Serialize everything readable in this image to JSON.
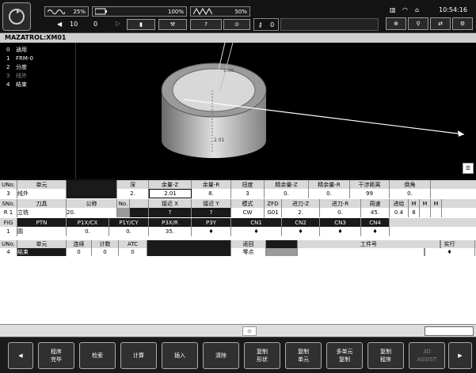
{
  "topbar": {
    "spindle_pct": "25%",
    "feed_pct": "100%",
    "rapid_pct": "50%",
    "step_value": "10",
    "step_value2": "0",
    "counter": "0",
    "clock": "10:54:16"
  },
  "title": "MAZATROL:XM01",
  "menu": [
    {
      "num": "0",
      "label": "通用"
    },
    {
      "num": "1",
      "label": "FRM-0"
    },
    {
      "num": "2",
      "label": "分度"
    },
    {
      "num": "3",
      "label": "线外"
    },
    {
      "num": "4",
      "label": "结束"
    }
  ],
  "view": {
    "label1": "1.36",
    "label2": "2.01"
  },
  "unit_table": {
    "header": [
      "UNo.",
      "单元",
      "",
      "深",
      "余量-Z",
      "余量-R",
      "扭度",
      "精余量-Z",
      "精余量-R",
      "干涉距离",
      "倒角"
    ],
    "row": [
      "3",
      "线外",
      "",
      "2.",
      "2.01",
      "8.",
      "3",
      "0.",
      "0.",
      "99",
      "0."
    ]
  },
  "tool_table": {
    "header": [
      "SNo.",
      "刀具",
      "公称",
      "No.",
      "",
      "接近 X",
      "接近 Y",
      "模式",
      "ZFD",
      "进刀-Z",
      "进刀-R",
      "周速",
      "进给",
      "M",
      "M",
      "M"
    ],
    "row": [
      "R 1",
      "立铣",
      "20.",
      "",
      "",
      "?",
      "?",
      "CW",
      "G01",
      "2.",
      "0.",
      "45.",
      "0.4",
      "8",
      "",
      ""
    ]
  },
  "fig_table": {
    "header": [
      "FIG",
      "PTN",
      "P1X/CX",
      "P1Y/CY",
      "P3X/R",
      "P3Y",
      "CN1",
      "CN2",
      "CN3",
      "CN4"
    ],
    "row": [
      "1",
      "圆",
      "0.",
      "0.",
      "35.",
      "♦",
      "♦",
      "♦",
      "♦",
      "♦"
    ]
  },
  "end_table": {
    "header": [
      "UNo.",
      "单元",
      "连续",
      "计数",
      "ATC",
      "",
      "返回",
      "",
      "工件号",
      "",
      "实行"
    ],
    "row": [
      "4",
      "结束",
      "0",
      "0",
      "0",
      "",
      "零点",
      "",
      "",
      "",
      "♦"
    ]
  },
  "fkeys": [
    {
      "l1": "程序",
      "l2": "完毕"
    },
    {
      "l1": "检索",
      "l2": ""
    },
    {
      "l1": "计算",
      "l2": ""
    },
    {
      "l1": "插入",
      "l2": ""
    },
    {
      "l1": "清除",
      "l2": ""
    },
    {
      "l1": "复制",
      "l2": "形状"
    },
    {
      "l1": "复制",
      "l2": "单元"
    },
    {
      "l1": "多单元",
      "l2": "复制"
    },
    {
      "l1": "复制",
      "l2": "程序"
    },
    {
      "l1": "3D",
      "l2": "ASSIST"
    }
  ]
}
